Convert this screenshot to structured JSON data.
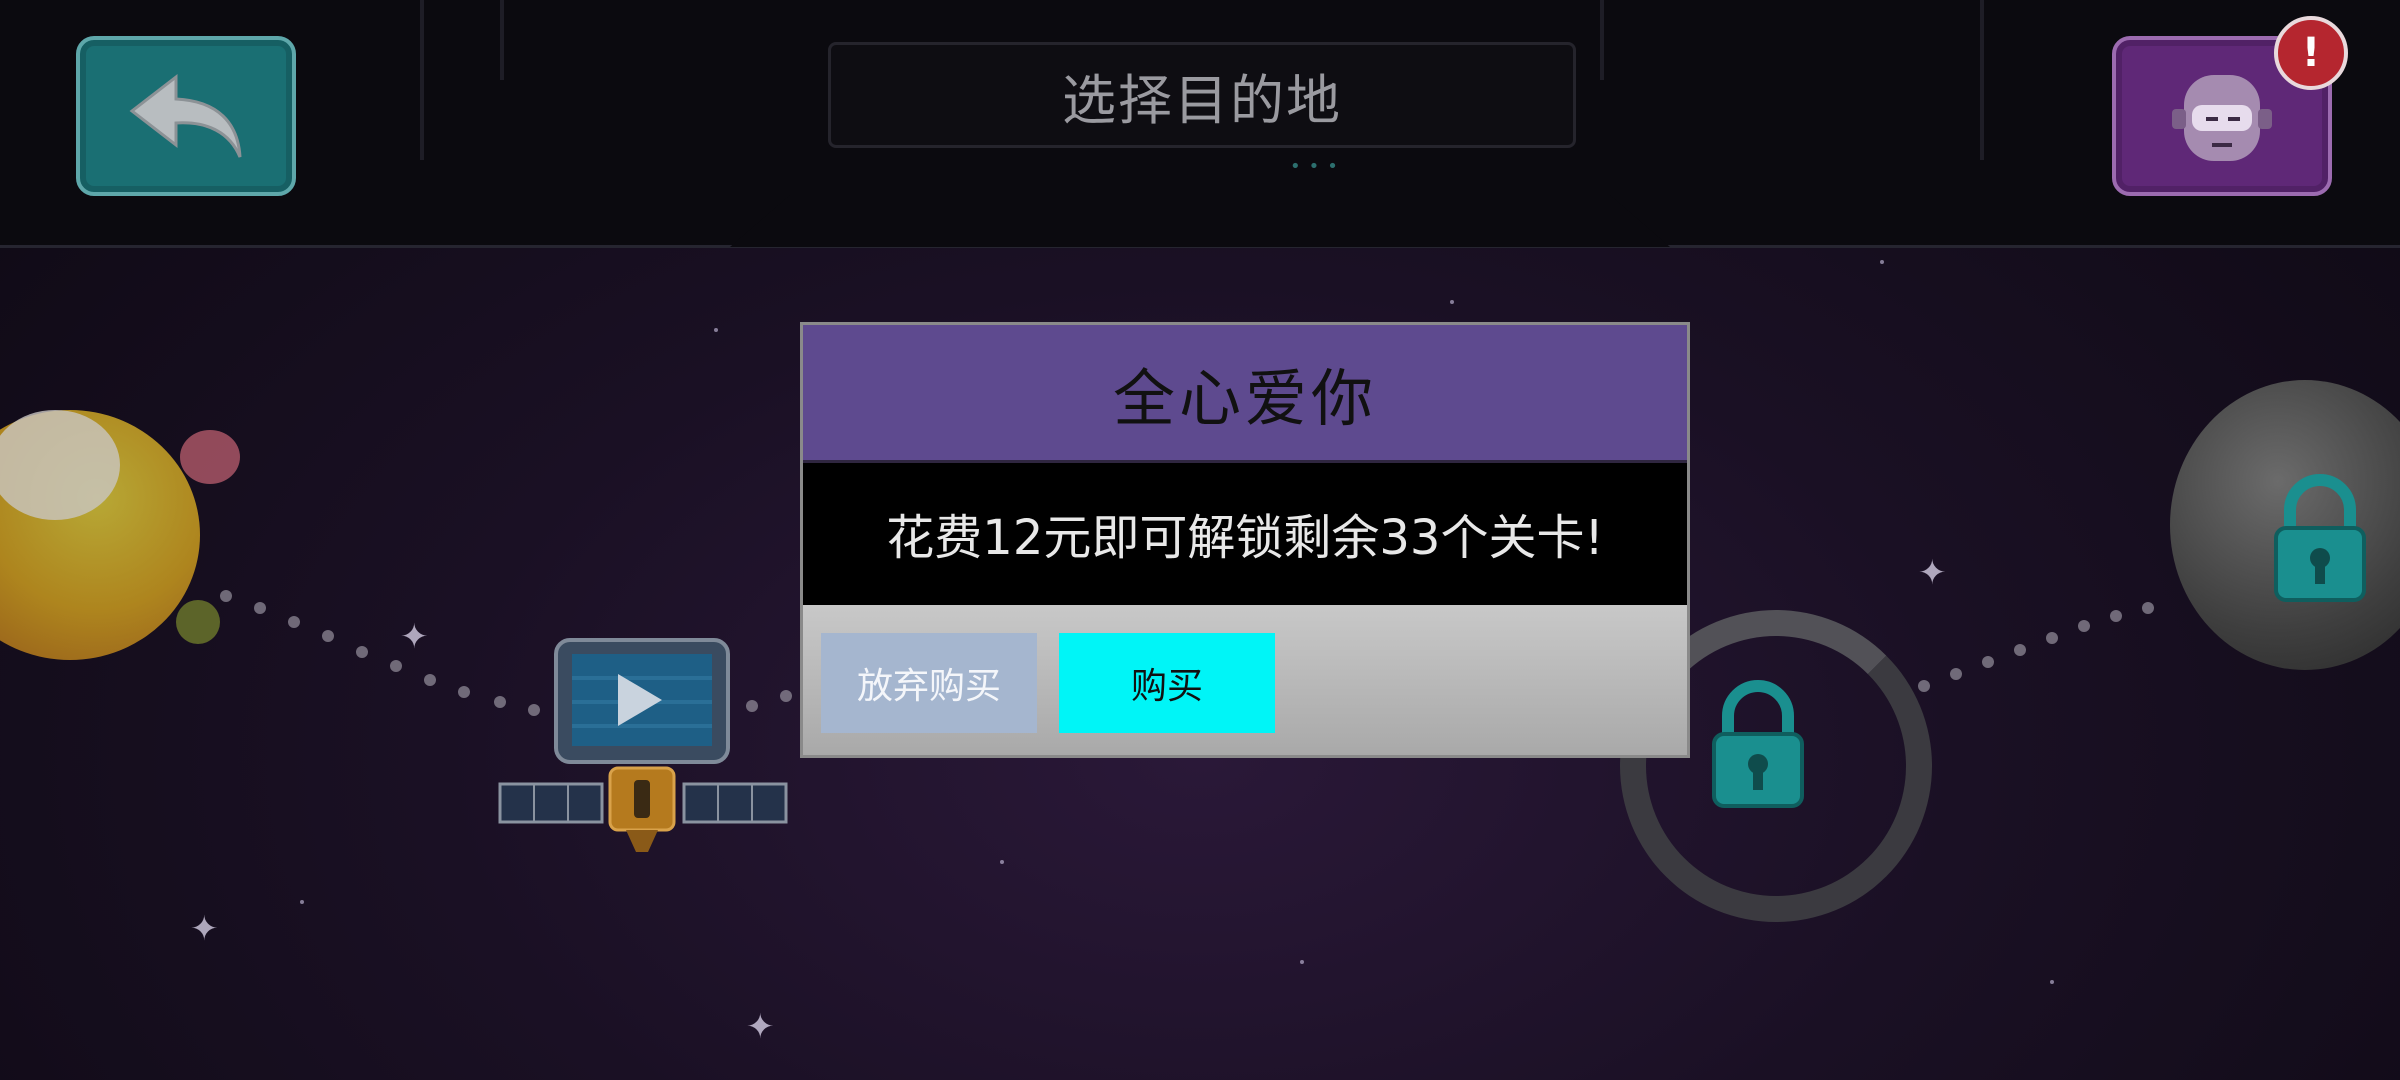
{
  "header": {
    "title": "选择目的地",
    "back_icon": "back-arrow-icon",
    "avatar_icon": "robot-face-icon",
    "alert_badge": "!"
  },
  "map": {
    "nodes": [
      {
        "name": "planet-left",
        "locked": false
      },
      {
        "name": "video-satellite",
        "icon": "play-icon"
      },
      {
        "name": "broken-ring-station",
        "locked": true
      },
      {
        "name": "planet-right",
        "locked": true
      }
    ]
  },
  "dialog": {
    "title": "全心爱你",
    "message": "花费12元即可解锁剩余33个关卡!",
    "decline_label": "放弃购买",
    "buy_label": "购买"
  },
  "colors": {
    "dialog_header": "#5e4a8f",
    "buy_button": "#00f5f7",
    "decline_button": "#a5b6cf",
    "back_button": "#1a6f73",
    "avatar_button": "#5f2877",
    "lock": "#1a8f8f"
  }
}
